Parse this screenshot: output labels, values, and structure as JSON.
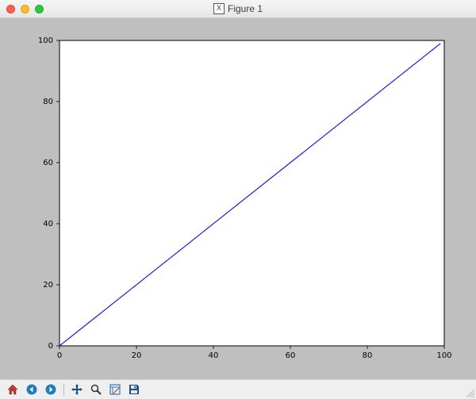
{
  "window": {
    "title": "Figure 1"
  },
  "chart_data": {
    "type": "line",
    "x": [
      0,
      99
    ],
    "y": [
      0,
      99
    ],
    "xlabel": "",
    "ylabel": "",
    "title": "",
    "xlim": [
      0,
      100
    ],
    "ylim": [
      0,
      100
    ],
    "xticks": [
      0,
      20,
      40,
      60,
      80,
      100
    ],
    "yticks": [
      0,
      20,
      40,
      60,
      80,
      100
    ],
    "line_color": "#1f1fd6"
  },
  "toolbar": {
    "home": "Home",
    "back": "Back",
    "forward": "Forward",
    "pan": "Pan",
    "zoom": "Zoom",
    "subplots": "Configure subplots",
    "save": "Save"
  }
}
